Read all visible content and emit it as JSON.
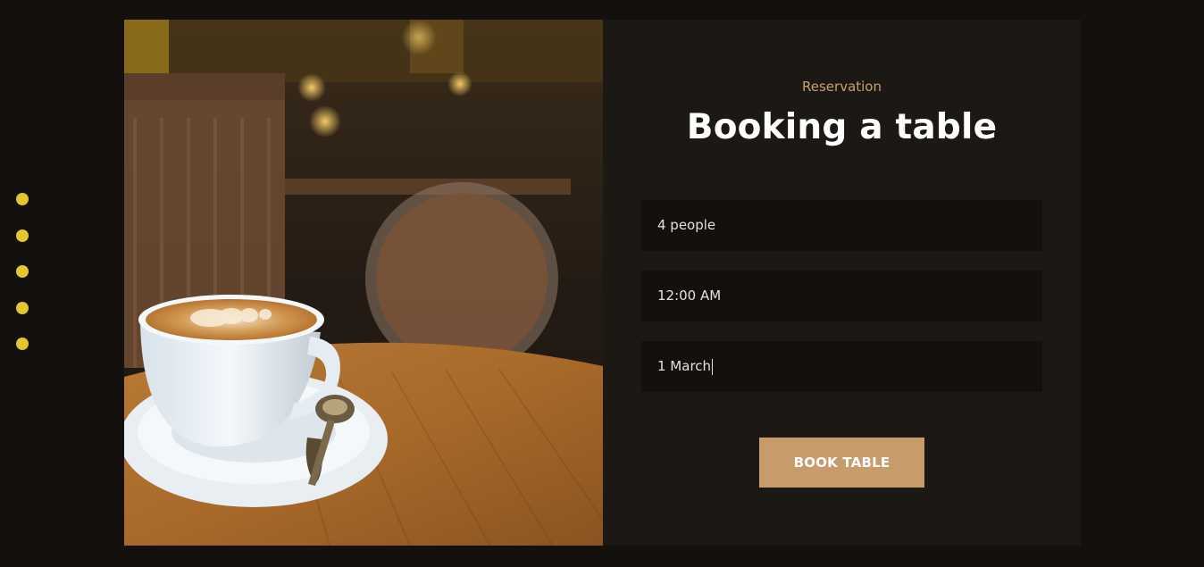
{
  "side_nav": {
    "dot_count": 5,
    "dot_color": "#e2c72f"
  },
  "photo": {
    "subject": "coffee-cup-icon"
  },
  "reservation": {
    "eyebrow": "Reservation",
    "title": "Booking a table",
    "fields": {
      "people": "4 people",
      "time": "12:00 AM",
      "date": "1 March"
    },
    "button_label": "BOOK TABLE"
  },
  "colors": {
    "accent": "#c89b6a",
    "background": "#14100d",
    "panel": "#1c1814"
  }
}
